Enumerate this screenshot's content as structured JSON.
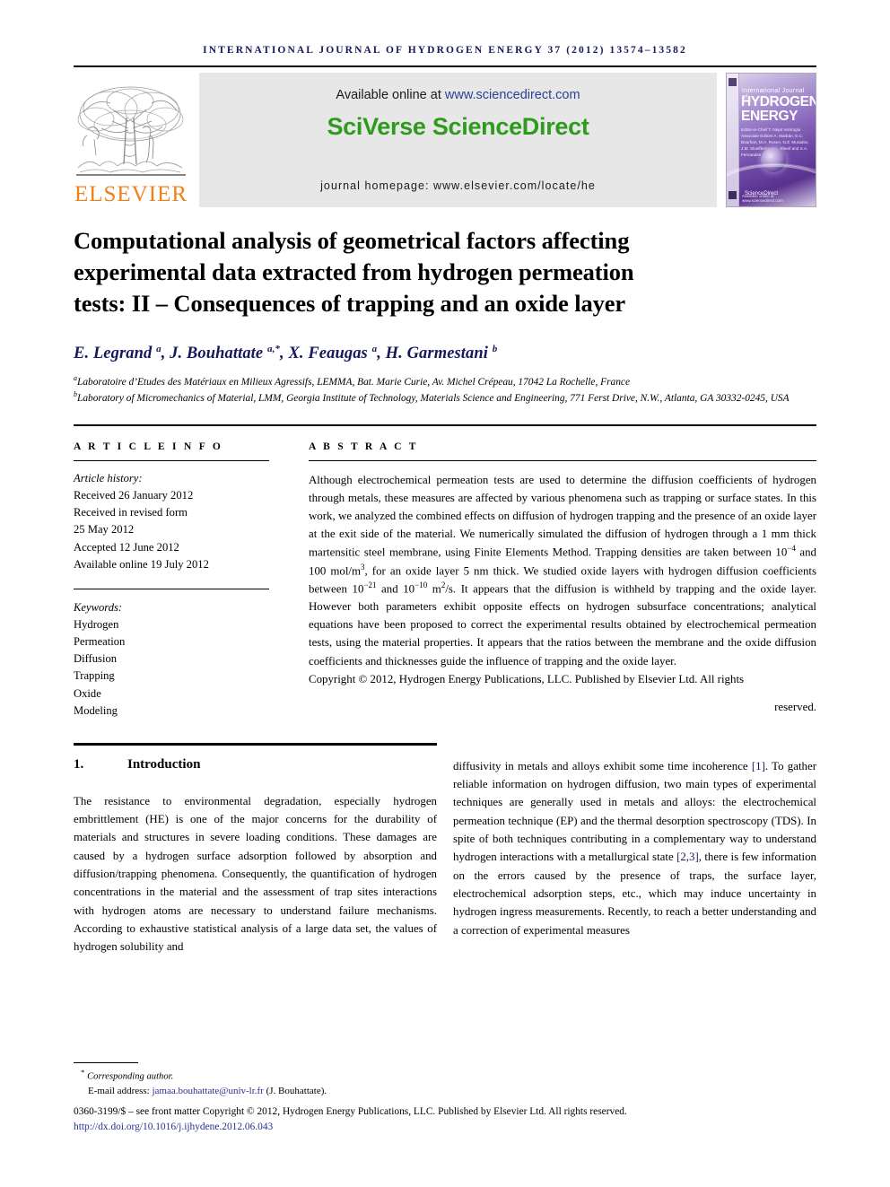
{
  "running_head": "INTERNATIONAL JOURNAL OF HYDROGEN ENERGY 37 (2012) 13574–13582",
  "masthead": {
    "publisher_name": "ELSEVIER",
    "available_prefix": "Available online at ",
    "sciencedirect_url": "www.sciencedirect.com",
    "sciverse_logo": "SciVerse ScienceDirect",
    "journal_homepage": "journal homepage: www.elsevier.com/locate/he",
    "cover": {
      "line_small": "International Journal of",
      "line_big_1": "HYDROGEN",
      "line_big_2": "ENERGY",
      "editors": "Editor-in-Chief  T. Nejat Veziroglu\nAssociate Editors  A. Marbán, E.C. Bourhan, M.A. Rosen,\nN.Z. Muradov, J.M. Stuelfberg,\nS.A. Sherif and S.A. Fernandes",
      "science_direct_mark": "ScienceDirect",
      "bottom_note": "Available online at www.sciencedirect.com"
    }
  },
  "article": {
    "title_line_1": "Computational analysis of geometrical factors affecting",
    "title_line_2": "experimental data extracted from hydrogen permeation",
    "title_line_3": "tests: II – Consequences of trapping and an oxide layer",
    "authors_html": "E. Legrand <sup>a</sup>, J. Bouhattate <sup>a,*</sup>, X. Feaugas <sup>a</sup>, H. Garmestani <sup>b</sup>",
    "affiliation_a": "Laboratoire d’Etudes des Matériaux en Milieux Agressifs, LEMMA, Bat. Marie Curie, Av. Michel Crépeau, 17042 La Rochelle, France",
    "affiliation_b": "Laboratory of Micromechanics of Material, LMM, Georgia Institute of Technology, Materials Science and Engineering, 771 Ferst Drive, N.W., Atlanta, GA 30332-0245, USA",
    "affil_marker_a": "a",
    "affil_marker_b": "b"
  },
  "article_info": {
    "heading": "A R T I C L E   I N F O",
    "history_label": "Article history:",
    "history": [
      "Received 26 January 2012",
      "Received in revised form",
      "25 May 2012",
      "Accepted 12 June 2012",
      "Available online 19 July 2012"
    ],
    "keywords_label": "Keywords:",
    "keywords": [
      "Hydrogen",
      "Permeation",
      "Diffusion",
      "Trapping",
      "Oxide",
      "Modeling"
    ]
  },
  "abstract": {
    "heading": "A B S T R A C T",
    "part_1": "Although electrochemical permeation tests are used to determine the diffusion coefficients of hydrogen through metals, these measures are affected by various phenomena such as trapping or surface states. In this work, we analyzed the combined effects on diffusion of hydrogen trapping and the presence of an oxide layer at the exit side of the material. We numerically simulated the diffusion of hydrogen through a 1 mm thick martensitic steel membrane, using Finite Elements Method. Trapping densities are taken between 10",
    "sup_1": "−4",
    "part_2": " and 100 mol/m",
    "sup_2": "3",
    "part_3": ", for an oxide layer 5 nm thick. We studied oxide layers with hydrogen diffusion coefficients between 10",
    "sup_3": "−21",
    "part_4": " and 10",
    "sup_4": "−10",
    "part_5": " m",
    "sup_5": "2",
    "part_6": "/s. It appears that the diffusion is withheld by trapping and the oxide layer. However both parameters exhibit opposite effects on hydrogen subsurface concentrations; analytical equations have been proposed to correct the experimental results obtained by electrochemical permeation tests, using the material properties. It appears that the ratios between the membrane and the oxide diffusion coefficients and thicknesses guide the influence of trapping and the oxide layer.",
    "copyright": "Copyright © 2012, Hydrogen Energy Publications, LLC. Published by Elsevier Ltd. All rights",
    "copyright_last": "reserved."
  },
  "body": {
    "section_number": "1.",
    "section_title": "Introduction",
    "left_paragraph": "The resistance to environmental degradation, especially hydrogen embrittlement (HE) is one of the major concerns for the durability of materials and structures in severe loading conditions. These damages are caused by a hydrogen surface adsorption followed by absorption and diffusion/trapping phenomena. Consequently, the quantification of hydrogen concentrations in the material and the assessment of trap sites interactions with hydrogen atoms are necessary to understand failure mechanisms. According to exhaustive statistical analysis of a large data set, the values of hydrogen solubility and",
    "right_part_1": "diffusivity in metals and alloys exhibit some time incoherence ",
    "right_ref_1": "[1]",
    "right_part_2": ". To gather reliable information on hydrogen diffusion, two main types of experimental techniques are generally used in metals and alloys: the electrochemical permeation technique (EP) and the thermal desorption spectroscopy (TDS). In spite of both techniques contributing in a complementary way to understand hydrogen interactions with a metallurgical state ",
    "right_ref_2": "[2,3]",
    "right_part_3": ", there is few information on the errors caused by the presence of traps, the surface layer, electrochemical adsorption steps, etc., which may induce uncertainty in hydrogen ingress measurements. Recently, to reach a better understanding and a correction of experimental measures"
  },
  "footer": {
    "corresponding_marker": "*",
    "corresponding": "Corresponding author.",
    "email_label": "E-mail address: ",
    "email": "jamaa.bouhattate@univ-lr.fr",
    "email_suffix": " (J. Bouhattate).",
    "issn_line": "0360-3199/$ – see front matter Copyright © 2012, Hydrogen Energy Publications, LLC. Published by Elsevier Ltd. All rights reserved.",
    "doi": "http://dx.doi.org/10.1016/j.ijhydene.2012.06.043"
  },
  "colors": {
    "journal_blue": "#16185c",
    "elsevier_orange": "#f08019",
    "sciverse_green": "#2f9a1e",
    "link_blue": "#2a2f8f"
  }
}
